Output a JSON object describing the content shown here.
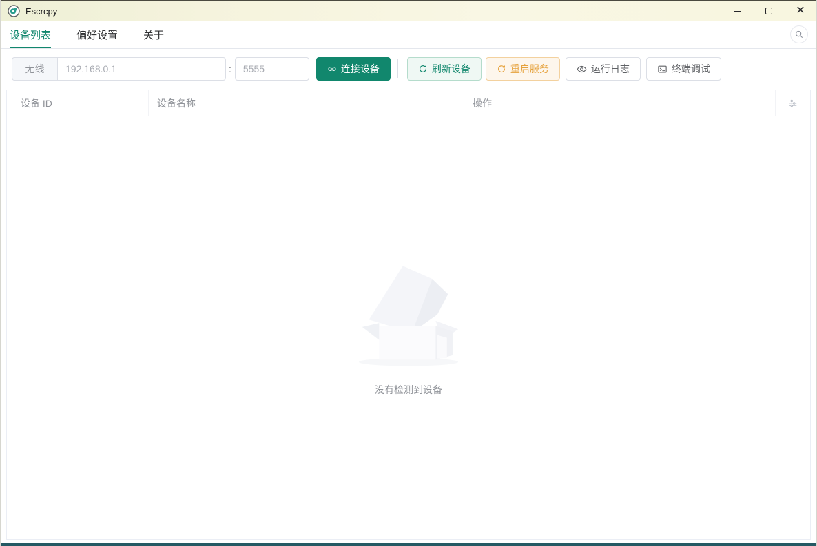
{
  "window": {
    "title": "Escrcpy"
  },
  "tabs": [
    {
      "label": "设备列表"
    },
    {
      "label": "偏好设置"
    },
    {
      "label": "关于"
    }
  ],
  "toolbar": {
    "wireless_label": "无线",
    "ip_placeholder": "192.168.0.1",
    "separator": ":",
    "port_placeholder": "5555",
    "connect_label": "连接设备",
    "refresh_label": "刷新设备",
    "restart_label": "重启服务",
    "logs_label": "运行日志",
    "terminal_label": "终端调试"
  },
  "table": {
    "columns": [
      {
        "label": "设备 ID"
      },
      {
        "label": "设备名称"
      },
      {
        "label": "操作"
      }
    ],
    "empty_text": "没有检测到设备"
  },
  "icons": {
    "app": "escrcpy-logo",
    "search": "search-icon",
    "connect": "link-icon",
    "refresh": "refresh-icon",
    "restart": "refresh-right-icon",
    "logs": "eye-icon",
    "terminal": "terminal-icon",
    "table_tools": "sliders-icon"
  },
  "colors": {
    "primary": "#11876d",
    "warning": "#e6a23c",
    "titlebar_gradient": [
      "#eef0d6",
      "#f9f7e4"
    ],
    "bottom_edge": "#255963"
  }
}
